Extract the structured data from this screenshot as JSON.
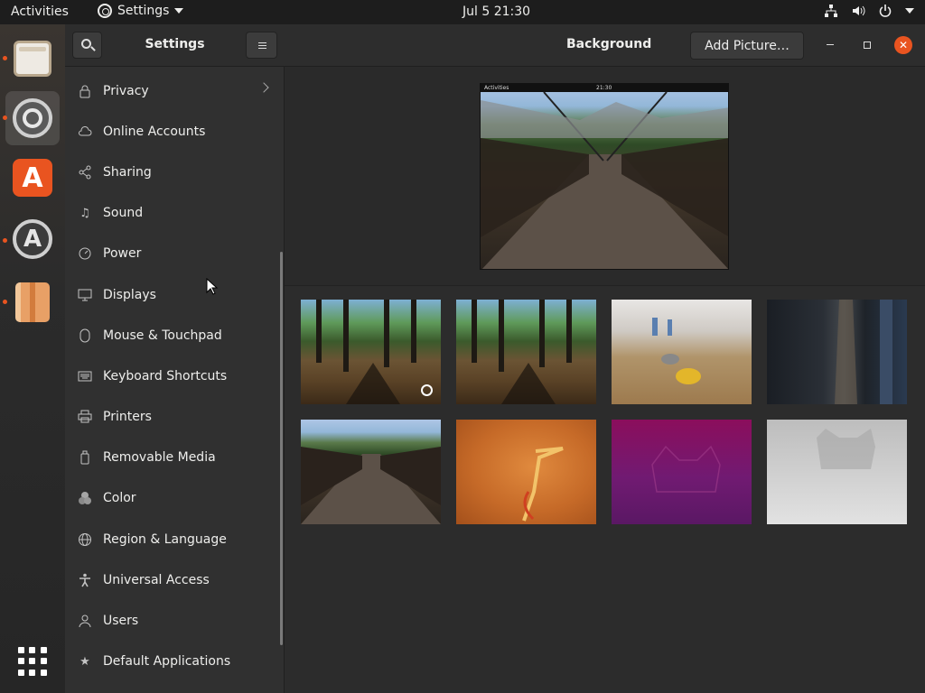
{
  "topbar": {
    "activities": "Activities",
    "app_name": "Settings",
    "clock": "Jul 5  21:30"
  },
  "dock": {
    "items": [
      "files-icon",
      "settings-icon",
      "software-store-icon",
      "software-updater-icon",
      "archive-icon",
      "show-apps-icon"
    ]
  },
  "sidebar": {
    "title": "Settings",
    "items": [
      {
        "label": "Privacy",
        "icon": "lock-icon"
      },
      {
        "label": "Online Accounts",
        "icon": "cloud-icon"
      },
      {
        "label": "Sharing",
        "icon": "share-icon"
      },
      {
        "label": "Sound",
        "icon": "music-note-icon"
      },
      {
        "label": "Power",
        "icon": "power-icon"
      },
      {
        "label": "Displays",
        "icon": "display-icon"
      },
      {
        "label": "Mouse & Touchpad",
        "icon": "mouse-icon"
      },
      {
        "label": "Keyboard Shortcuts",
        "icon": "keyboard-icon"
      },
      {
        "label": "Printers",
        "icon": "printer-icon"
      },
      {
        "label": "Removable Media",
        "icon": "usb-icon"
      },
      {
        "label": "Color",
        "icon": "color-icon"
      },
      {
        "label": "Region & Language",
        "icon": "globe-icon"
      },
      {
        "label": "Universal Access",
        "icon": "accessibility-icon"
      },
      {
        "label": "Users",
        "icon": "users-icon"
      },
      {
        "label": "Default Applications",
        "icon": "star-icon"
      }
    ]
  },
  "main": {
    "title": "Background",
    "add_picture": "Add Picture…",
    "preview": {
      "topbar_left": "Activities",
      "topbar_time": "21:30"
    },
    "wallpapers": [
      {
        "name": "forest-lake",
        "selected": true
      },
      {
        "name": "forest-lake-2",
        "selected": false
      },
      {
        "name": "table-shuffleboard",
        "selected": false
      },
      {
        "name": "train-station",
        "selected": false
      },
      {
        "name": "suspension-bridge",
        "selected": false
      },
      {
        "name": "orange-bird",
        "selected": false
      },
      {
        "name": "purple-cat",
        "selected": false
      },
      {
        "name": "grey-cat",
        "selected": false
      }
    ]
  },
  "colors": {
    "accent": "#e95420",
    "sidebar_bg": "#303030",
    "topbar_bg": "#1d1d1d"
  }
}
